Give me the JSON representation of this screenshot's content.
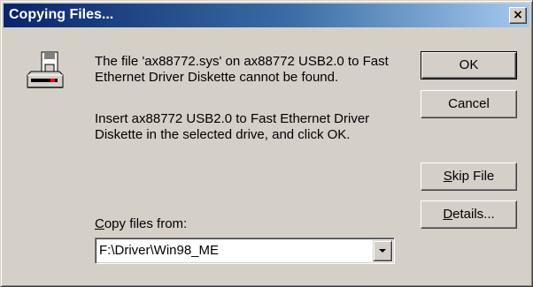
{
  "window": {
    "title": "Copying Files...",
    "close_glyph": "×"
  },
  "icon": "floppy-drive-icon",
  "message": {
    "line1": "The file 'ax88772.sys' on ax88772 USB2.0 to Fast Ethernet Driver Diskette cannot be found.",
    "line2": "Insert ax88772 USB2.0 to Fast Ethernet Driver Diskette in the selected drive, and click OK."
  },
  "buttons": {
    "ok": "OK",
    "cancel": "Cancel",
    "skip_file_accel": "S",
    "skip_file_rest": "kip File",
    "details_accel": "D",
    "details_rest": "etails..."
  },
  "copy_from": {
    "label_accel": "C",
    "label_rest": "opy files from:",
    "value": "F:\\Driver\\Win98_ME"
  },
  "colors": {
    "title_bar_start": "#0a246a",
    "title_bar_end": "#a6caf0",
    "face": "#d4d0c8"
  }
}
